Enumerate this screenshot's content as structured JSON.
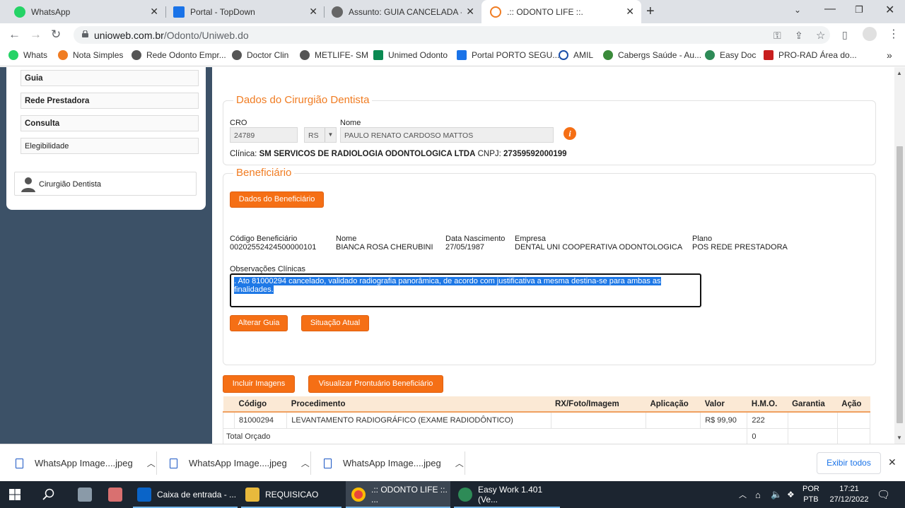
{
  "browser": {
    "tabs": [
      {
        "title": "WhatsApp",
        "active": false,
        "color": "#25d366"
      },
      {
        "title": "Portal - TopDown",
        "active": false,
        "color": "#1a73e8"
      },
      {
        "title": "Assunto: GUIA CANCELADA - GTO",
        "active": false,
        "color": "#666666"
      },
      {
        "title": ".:: ODONTO LIFE ::.",
        "active": true,
        "color": "#f07c22"
      }
    ],
    "url_host": "unioweb.com.br",
    "url_path": "/Odonto/Uniweb.do",
    "bookmarks": [
      {
        "label": "Whats",
        "color": "#25d366"
      },
      {
        "label": "Nota Simples",
        "color": "#f07c22"
      },
      {
        "label": "Rede Odonto Empr...",
        "color": "#555555"
      },
      {
        "label": "Doctor Clin",
        "color": "#555555"
      },
      {
        "label": "METLIFE- SM",
        "color": "#555555"
      },
      {
        "label": "Unimed Odonto",
        "color": "#0a8a52"
      },
      {
        "label": "Portal PORTO SEGU...",
        "color": "#1a73e8"
      },
      {
        "label": "AMIL",
        "color": "#1a4ea8"
      },
      {
        "label": "Cabergs Saúde - Au...",
        "color": "#3a8a3a"
      },
      {
        "label": "Easy Doc",
        "color": "#2e8b57"
      },
      {
        "label": "PRO-RAD Área do...",
        "color": "#c81e1e"
      }
    ]
  },
  "sidebar": {
    "items": [
      {
        "label": "Guia"
      },
      {
        "label": "Rede Prestadora"
      },
      {
        "label": "Consulta"
      },
      {
        "label": "Elegibilidade"
      }
    ],
    "dentist_label": "Cirurgião Dentista"
  },
  "dentist": {
    "legend": "Dados do Cirurgião Dentista",
    "cro_label": "CRO",
    "cro_value": "24789",
    "uf_value": "RS",
    "name_label": "Nome",
    "name_value": "PAULO RENATO CARDOSO MATTOS",
    "clinic_prefix": "Clínica:",
    "clinic_name": "SM SERVICOS DE RADIOLOGIA ODONTOLOGICA LTDA",
    "cnpj_prefix": "CNPJ:",
    "cnpj_value": "27359592000199"
  },
  "beneficiary": {
    "legend": "Beneficiário",
    "data_button": "Dados do Beneficiário",
    "code_label": "Código Beneficiário",
    "code_value": "00202552424500000101",
    "name_label": "Nome",
    "name_value": "BIANCA ROSA CHERUBINI",
    "birth_label": "Data Nascimento",
    "birth_value": "27/05/1987",
    "company_label": "Empresa",
    "company_value": "DENTAL UNI COOPERATIVA ODONTOLOGICA",
    "plan_label": "Plano",
    "plan_value": "POS REDE PRESTADORA",
    "obs_label": "Observações Clínicas",
    "obs_text": ". Ato 81000294 cancelado, validado radiografia panorâmica, de acordo com justificativa a mesma destina-se para ambas as finalidades.",
    "alter_button": "Alterar Guia",
    "status_button": "Situação Atual"
  },
  "actions": {
    "include_images": "Incluir Imagens",
    "view_record": "Visualizar Prontuário Beneficiário"
  },
  "procedures": {
    "headers": [
      "Código",
      "Procedimento",
      "RX/Foto/Imagem",
      "Aplicação",
      "Valor",
      "H.M.O.",
      "Garantia",
      "Ação"
    ],
    "rows": [
      [
        "81000294",
        "LEVANTAMENTO RADIOGRÁFICO (EXAME RADIODÔNTICO)",
        "",
        "",
        "R$ 99,90",
        "222",
        "",
        ""
      ]
    ],
    "total_label": "Total Orçado",
    "total_hmo": "0"
  },
  "downloads": {
    "items": [
      "WhatsApp Image....jpeg",
      "WhatsApp Image....jpeg",
      "WhatsApp Image....jpeg"
    ],
    "show_all": "Exibir todos"
  },
  "taskbar": {
    "apps": [
      {
        "label": "Caixa de entrada - ...",
        "color": "#0a64c8"
      },
      {
        "label": "REQUISICAO",
        "color": "#e8b93c"
      },
      {
        "label": ".:: ODONTO LIFE ::. ...",
        "color": "#e8453c"
      },
      {
        "label": "Easy Work 1.401 (Ve...",
        "color": "#2e8b57"
      }
    ],
    "lang_top": "POR",
    "lang_bottom": "PTB",
    "time": "17:21",
    "date": "27/12/2022"
  }
}
